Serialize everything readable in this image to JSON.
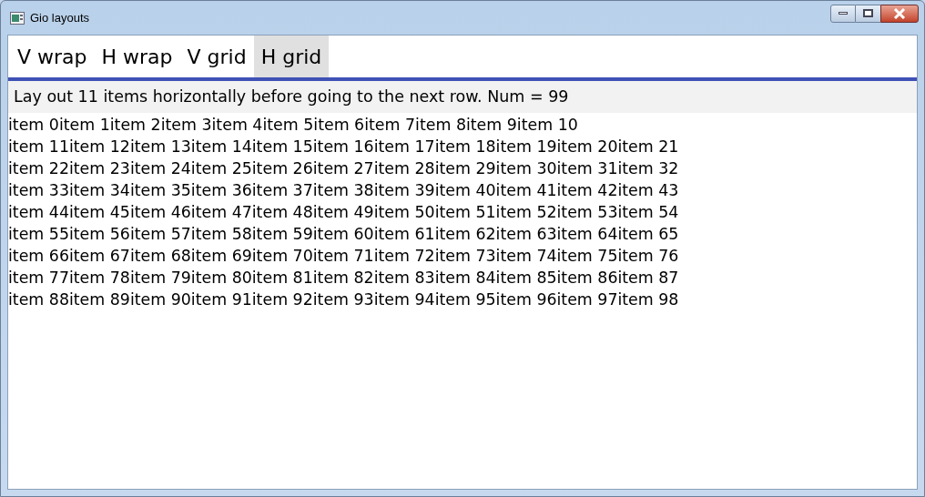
{
  "window": {
    "title": "Gio layouts"
  },
  "tabs": [
    {
      "label": "V wrap",
      "selected": false
    },
    {
      "label": "H wrap",
      "selected": false
    },
    {
      "label": "V grid",
      "selected": false
    },
    {
      "label": "H grid",
      "selected": true
    }
  ],
  "description": "Lay out 11 items horizontally before going to the next row. Num = 99",
  "item_lines": [
    "item 0item 1item 2item 3item 4item 5item 6item 7item 8item 9item 10",
    "item 11item 12item 13item 14item 15item 16item 17item 18item 19item 20item 21",
    "item 22item 23item 24item 25item 26item 27item 28item 29item 30item 31item 32",
    "item 33item 34item 35item 36item 37item 38item 39item 40item 41item 42item 43",
    "item 44item 45item 46item 47item 48item 49item 50item 51item 52item 53item 54",
    "item 55item 56item 57item 58item 59item 60item 61item 62item 63item 64item 65",
    "item 66item 67item 68item 69item 70item 71item 72item 73item 74item 75item 76",
    "item 77item 78item 79item 80item 81item 82item 83item 84item 85item 86item 87",
    "item 88item 89item 90item 91item 92item 93item 94item 95item 96item 97item 98"
  ]
}
